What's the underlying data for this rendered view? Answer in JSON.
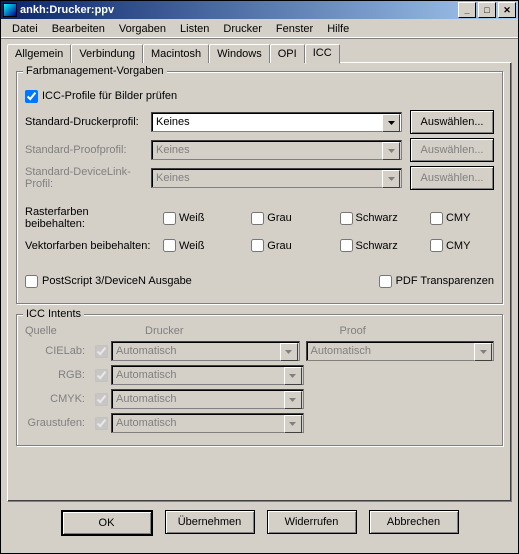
{
  "window": {
    "title": "ankh:Drucker:ppv"
  },
  "menu": {
    "items": [
      "Datei",
      "Bearbeiten",
      "Vorgaben",
      "Listen",
      "Drucker",
      "Fenster",
      "Hilfe"
    ]
  },
  "tabs": {
    "items": [
      "Allgemein",
      "Verbindung",
      "Macintosh",
      "Windows",
      "OPI",
      "ICC"
    ],
    "active": 5
  },
  "group1": {
    "legend": "Farbmanagement-Vorgaben",
    "checkProfiles": "ICC-Profile für Bilder prüfen",
    "stdPrinter": {
      "label": "Standard-Druckerprofil:",
      "value": "Keines",
      "button": "Auswählen..."
    },
    "stdProof": {
      "label": "Standard-Proofprofil:",
      "value": "Keines",
      "button": "Auswählen..."
    },
    "stdDevLink": {
      "label": "Standard-DeviceLink-Profil:",
      "value": "Keines",
      "button": "Auswählen..."
    },
    "raster": {
      "label": "Rasterfarben beibehalten:",
      "opts": [
        "Weiß",
        "Grau",
        "Schwarz",
        "CMY"
      ]
    },
    "vector": {
      "label": "Vektorfarben beibehalten:",
      "opts": [
        "Weiß",
        "Grau",
        "Schwarz",
        "CMY"
      ]
    },
    "ps3": "PostScript 3/DeviceN Ausgabe",
    "pdfTrans": "PDF Transparenzen"
  },
  "group2": {
    "legend": "ICC Intents",
    "hdr": {
      "source": "Quelle",
      "printer": "Drucker",
      "proof": "Proof"
    },
    "rows": {
      "cielab": {
        "label": "CIELab:",
        "printer": "Automatisch",
        "proof": "Automatisch"
      },
      "rgb": {
        "label": "RGB:",
        "printer": "Automatisch"
      },
      "cmyk": {
        "label": "CMYK:",
        "printer": "Automatisch"
      },
      "gray": {
        "label": "Graustufen:",
        "printer": "Automatisch"
      }
    }
  },
  "buttons": {
    "ok": "OK",
    "apply": "Übernehmen",
    "revert": "Widerrufen",
    "cancel": "Abbrechen"
  }
}
